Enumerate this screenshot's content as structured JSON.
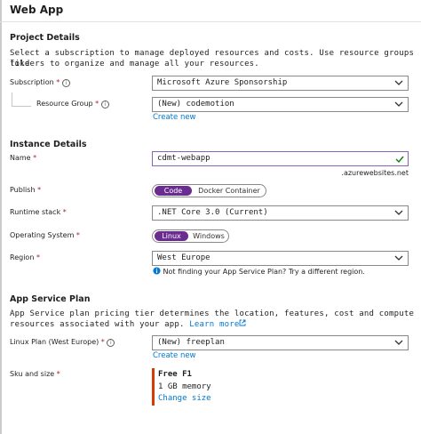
{
  "page": {
    "title": "Web App"
  },
  "project": {
    "title": "Project Details",
    "description_line1": "Select a subscription to manage deployed resources and costs. Use resource groups like",
    "description_line2": "folders to organize and manage all your resources.",
    "subscription": {
      "label": "Subscription",
      "required_mark": "*",
      "value": "Microsoft Azure Sponsorship"
    },
    "resource_group": {
      "label": "Resource Group",
      "required_mark": "*",
      "value": "(New) codemotion",
      "create_new": "Create new"
    }
  },
  "instance": {
    "title": "Instance Details",
    "name": {
      "label": "Name",
      "required_mark": "*",
      "value": "cdmt-webapp",
      "suffix": ".azurewebsites.net"
    },
    "publish": {
      "label": "Publish",
      "required_mark": "*",
      "options": [
        "Code",
        "Docker Container"
      ],
      "selected": "Code"
    },
    "runtime": {
      "label": "Runtime stack",
      "required_mark": "*",
      "value": ".NET Core 3.0 (Current)"
    },
    "os": {
      "label": "Operating System",
      "required_mark": "*",
      "options": [
        "Linux",
        "Windows"
      ],
      "selected": "Linux"
    },
    "region": {
      "label": "Region",
      "required_mark": "*",
      "value": "West Europe",
      "hint_prefix": "Not finding your App Service Plan? Try a different region."
    }
  },
  "plan": {
    "title": "App Service Plan",
    "description_line1": "App Service plan pricing tier determines the location, features, cost and compute",
    "description_line2": "resources associated with your app.",
    "learn_more": "Learn more",
    "linux_plan": {
      "label": "Linux Plan (West Europe)",
      "required_mark": "*",
      "value": "(New) freeplan",
      "create_new": "Create new"
    },
    "sku": {
      "label": "Sku and size",
      "required_mark": "*",
      "tier": "Free F1",
      "memory": "1 GB memory",
      "change": "Change size"
    }
  },
  "colors": {
    "accent": "#6b2c91",
    "link": "#0078d4",
    "valid": "#107c10",
    "required": "#a4262c",
    "sku_bar": "#d83b01"
  }
}
